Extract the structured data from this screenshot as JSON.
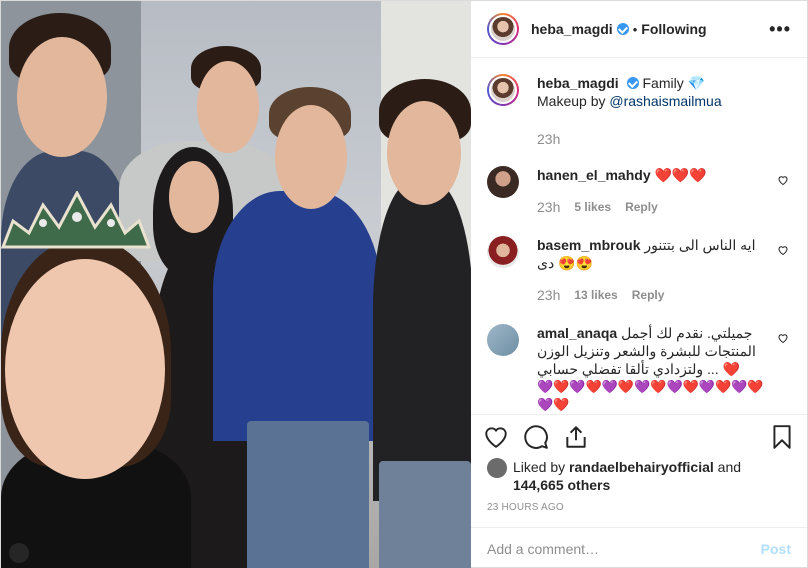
{
  "header": {
    "username": "heba_magdi",
    "separator": "•",
    "follow_status": "Following",
    "more": "•••"
  },
  "caption": {
    "username": "heba_magdi",
    "text": "Family",
    "line2_prefix": "Makeup by ",
    "mention": "@rashaismailmua",
    "emoji": "💎",
    "time": "23h"
  },
  "comments": [
    {
      "username": "hanen_el_mahdy",
      "text": "❤️❤️❤️",
      "time": "23h",
      "likes": "5 likes",
      "reply": "Reply"
    },
    {
      "username": "basem_mbrouk",
      "text": "ايه الناس الى بتتنور دى 😍😍",
      "time": "23h",
      "likes": "13 likes",
      "reply": "Reply"
    },
    {
      "username": "amal_anaqa",
      "text": "جميلتي. نقدم لك أجمل المنتجات للبشرة والشعر وتنزيل الوزن ولتزدادي تألقا تفضلي حسابي ... ❤️",
      "hearts": "💜❤️💜❤️💜❤️💜❤️💜❤️💜❤️💜❤️💜❤️"
    }
  ],
  "likes": {
    "prefix": "Liked by ",
    "user": "randaelbehairyofficial",
    "suffix": " and",
    "count": "144,665 others"
  },
  "time_ago": "23 HOURS AGO",
  "add_comment": {
    "placeholder": "Add a comment…",
    "post_label": "Post"
  },
  "colors": {
    "link": "#003569",
    "verified": "#3897f0",
    "muted": "#8e8e8e",
    "post_disabled": "#b2dffc"
  }
}
